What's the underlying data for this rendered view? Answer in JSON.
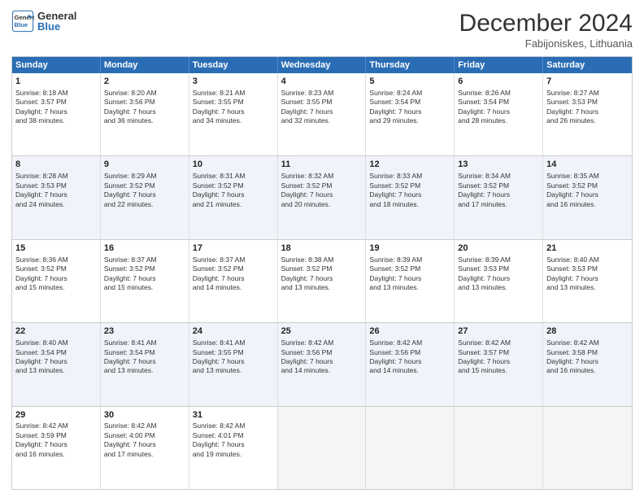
{
  "header": {
    "logo_line1": "General",
    "logo_line2": "Blue",
    "month_title": "December 2024",
    "location": "Fabijoniskes, Lithuania"
  },
  "days_of_week": [
    "Sunday",
    "Monday",
    "Tuesday",
    "Wednesday",
    "Thursday",
    "Friday",
    "Saturday"
  ],
  "weeks": [
    [
      {
        "day": "1",
        "lines": [
          "Sunrise: 8:18 AM",
          "Sunset: 3:57 PM",
          "Daylight: 7 hours",
          "and 38 minutes."
        ]
      },
      {
        "day": "2",
        "lines": [
          "Sunrise: 8:20 AM",
          "Sunset: 3:56 PM",
          "Daylight: 7 hours",
          "and 36 minutes."
        ]
      },
      {
        "day": "3",
        "lines": [
          "Sunrise: 8:21 AM",
          "Sunset: 3:55 PM",
          "Daylight: 7 hours",
          "and 34 minutes."
        ]
      },
      {
        "day": "4",
        "lines": [
          "Sunrise: 8:23 AM",
          "Sunset: 3:55 PM",
          "Daylight: 7 hours",
          "and 32 minutes."
        ]
      },
      {
        "day": "5",
        "lines": [
          "Sunrise: 8:24 AM",
          "Sunset: 3:54 PM",
          "Daylight: 7 hours",
          "and 29 minutes."
        ]
      },
      {
        "day": "6",
        "lines": [
          "Sunrise: 8:26 AM",
          "Sunset: 3:54 PM",
          "Daylight: 7 hours",
          "and 28 minutes."
        ]
      },
      {
        "day": "7",
        "lines": [
          "Sunrise: 8:27 AM",
          "Sunset: 3:53 PM",
          "Daylight: 7 hours",
          "and 26 minutes."
        ]
      }
    ],
    [
      {
        "day": "8",
        "lines": [
          "Sunrise: 8:28 AM",
          "Sunset: 3:53 PM",
          "Daylight: 7 hours",
          "and 24 minutes."
        ]
      },
      {
        "day": "9",
        "lines": [
          "Sunrise: 8:29 AM",
          "Sunset: 3:52 PM",
          "Daylight: 7 hours",
          "and 22 minutes."
        ]
      },
      {
        "day": "10",
        "lines": [
          "Sunrise: 8:31 AM",
          "Sunset: 3:52 PM",
          "Daylight: 7 hours",
          "and 21 minutes."
        ]
      },
      {
        "day": "11",
        "lines": [
          "Sunrise: 8:32 AM",
          "Sunset: 3:52 PM",
          "Daylight: 7 hours",
          "and 20 minutes."
        ]
      },
      {
        "day": "12",
        "lines": [
          "Sunrise: 8:33 AM",
          "Sunset: 3:52 PM",
          "Daylight: 7 hours",
          "and 18 minutes."
        ]
      },
      {
        "day": "13",
        "lines": [
          "Sunrise: 8:34 AM",
          "Sunset: 3:52 PM",
          "Daylight: 7 hours",
          "and 17 minutes."
        ]
      },
      {
        "day": "14",
        "lines": [
          "Sunrise: 8:35 AM",
          "Sunset: 3:52 PM",
          "Daylight: 7 hours",
          "and 16 minutes."
        ]
      }
    ],
    [
      {
        "day": "15",
        "lines": [
          "Sunrise: 8:36 AM",
          "Sunset: 3:52 PM",
          "Daylight: 7 hours",
          "and 15 minutes."
        ]
      },
      {
        "day": "16",
        "lines": [
          "Sunrise: 8:37 AM",
          "Sunset: 3:52 PM",
          "Daylight: 7 hours",
          "and 15 minutes."
        ]
      },
      {
        "day": "17",
        "lines": [
          "Sunrise: 8:37 AM",
          "Sunset: 3:52 PM",
          "Daylight: 7 hours",
          "and 14 minutes."
        ]
      },
      {
        "day": "18",
        "lines": [
          "Sunrise: 8:38 AM",
          "Sunset: 3:52 PM",
          "Daylight: 7 hours",
          "and 13 minutes."
        ]
      },
      {
        "day": "19",
        "lines": [
          "Sunrise: 8:39 AM",
          "Sunset: 3:52 PM",
          "Daylight: 7 hours",
          "and 13 minutes."
        ]
      },
      {
        "day": "20",
        "lines": [
          "Sunrise: 8:39 AM",
          "Sunset: 3:53 PM",
          "Daylight: 7 hours",
          "and 13 minutes."
        ]
      },
      {
        "day": "21",
        "lines": [
          "Sunrise: 8:40 AM",
          "Sunset: 3:53 PM",
          "Daylight: 7 hours",
          "and 13 minutes."
        ]
      }
    ],
    [
      {
        "day": "22",
        "lines": [
          "Sunrise: 8:40 AM",
          "Sunset: 3:54 PM",
          "Daylight: 7 hours",
          "and 13 minutes."
        ]
      },
      {
        "day": "23",
        "lines": [
          "Sunrise: 8:41 AM",
          "Sunset: 3:54 PM",
          "Daylight: 7 hours",
          "and 13 minutes."
        ]
      },
      {
        "day": "24",
        "lines": [
          "Sunrise: 8:41 AM",
          "Sunset: 3:55 PM",
          "Daylight: 7 hours",
          "and 13 minutes."
        ]
      },
      {
        "day": "25",
        "lines": [
          "Sunrise: 8:42 AM",
          "Sunset: 3:56 PM",
          "Daylight: 7 hours",
          "and 14 minutes."
        ]
      },
      {
        "day": "26",
        "lines": [
          "Sunrise: 8:42 AM",
          "Sunset: 3:56 PM",
          "Daylight: 7 hours",
          "and 14 minutes."
        ]
      },
      {
        "day": "27",
        "lines": [
          "Sunrise: 8:42 AM",
          "Sunset: 3:57 PM",
          "Daylight: 7 hours",
          "and 15 minutes."
        ]
      },
      {
        "day": "28",
        "lines": [
          "Sunrise: 8:42 AM",
          "Sunset: 3:58 PM",
          "Daylight: 7 hours",
          "and 16 minutes."
        ]
      }
    ],
    [
      {
        "day": "29",
        "lines": [
          "Sunrise: 8:42 AM",
          "Sunset: 3:59 PM",
          "Daylight: 7 hours",
          "and 16 minutes."
        ]
      },
      {
        "day": "30",
        "lines": [
          "Sunrise: 8:42 AM",
          "Sunset: 4:00 PM",
          "Daylight: 7 hours",
          "and 17 minutes."
        ]
      },
      {
        "day": "31",
        "lines": [
          "Sunrise: 8:42 AM",
          "Sunset: 4:01 PM",
          "Daylight: 7 hours",
          "and 19 minutes."
        ]
      },
      {
        "day": "",
        "lines": []
      },
      {
        "day": "",
        "lines": []
      },
      {
        "day": "",
        "lines": []
      },
      {
        "day": "",
        "lines": []
      }
    ]
  ]
}
